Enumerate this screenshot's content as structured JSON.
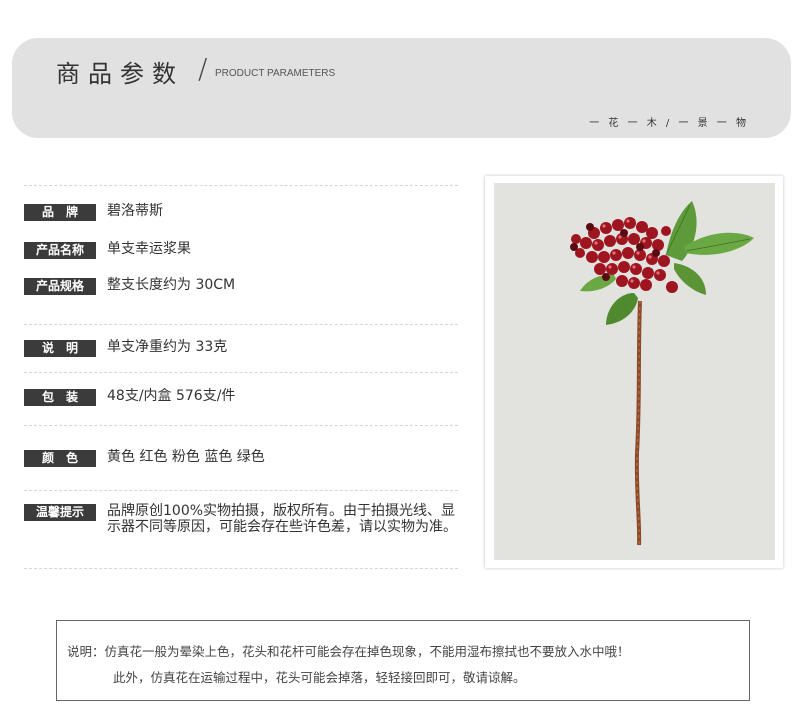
{
  "header": {
    "title": "商品参数",
    "slash": "/",
    "subtitle": "PRODUCT PARAMETERS",
    "motto": "一 花 一 木 / 一 景 一 物"
  },
  "params": [
    {
      "label": "品　牌",
      "value": "碧洛蒂斯"
    },
    {
      "label": "产品名称",
      "value": "单支幸运浆果"
    },
    {
      "label": "产品规格",
      "value": "整支长度约为 30CM"
    },
    {
      "label": "说　明",
      "value": "单支净重约为 33克"
    },
    {
      "label": "包　装",
      "value": "48支/内盒 576支/件"
    },
    {
      "label": "颜　色",
      "value": "黄色 红色 粉色 蓝色 绿色"
    },
    {
      "label": "温馨提示",
      "value": "品牌原创100%实物拍摄，版权所有。由于拍摄光线、显示器不同等原因，可能会存在些许色差，请以实物为准。"
    }
  ],
  "note": {
    "line1": "说明：仿真花一般为晕染上色，花头和花杆可能会存在掉色现象，不能用湿布擦拭也不要放入水中哦！",
    "line2": "此外，仿真花在运输过程中，花头可能会掉落，轻轻接回即可，敬请谅解。"
  },
  "colors": {
    "header_bg": "#e1e1e1",
    "tag_bg": "#3b3b3b",
    "berry": "#9e1520",
    "leaf": "#5c9a3a",
    "stem": "#8a4a2a"
  }
}
